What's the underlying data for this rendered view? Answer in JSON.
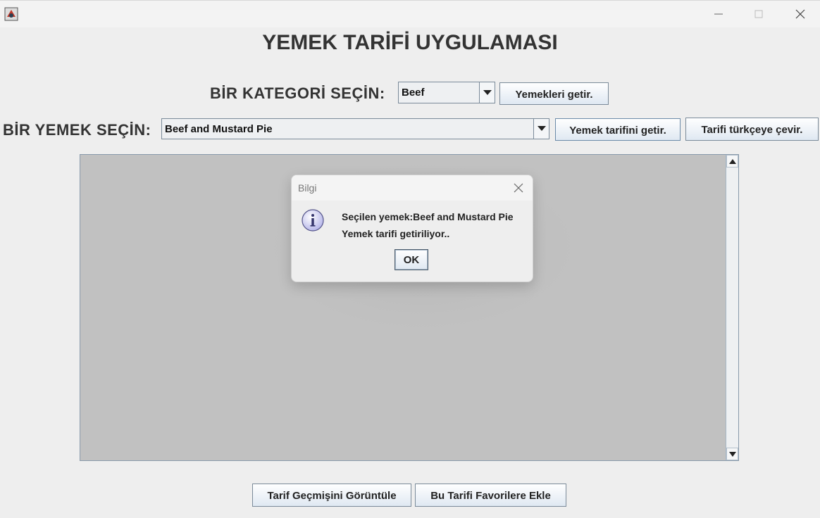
{
  "window": {
    "heading": "YEMEK TARİFİ UYGULAMASI"
  },
  "category": {
    "label": "BİR KATEGORİ SEÇİN:",
    "selected": "Beef",
    "get_meals_button": "Yemekleri getir."
  },
  "meal": {
    "label": "BİR YEMEK SEÇİN:",
    "selected": "Beef and Mustard Pie",
    "get_recipe_button": "Yemek tarifini getir.",
    "translate_button": "Tarifi türkçeye çevir."
  },
  "footer": {
    "history_button": "Tarif Geçmişini Görüntüle",
    "favorite_button": "Bu Tarifi Favorilere Ekle"
  },
  "dialog": {
    "title": "Bilgi",
    "line1": "Seçilen yemek:Beef and Mustard Pie",
    "line2": "Yemek tarifi getiriliyor..",
    "ok_label": "OK",
    "icon": "info-icon"
  },
  "colors": {
    "text_area_bg": "#c1c1c1",
    "window_bg": "#eeeeee",
    "button_gradient_bottom": "#dfe8f2"
  }
}
